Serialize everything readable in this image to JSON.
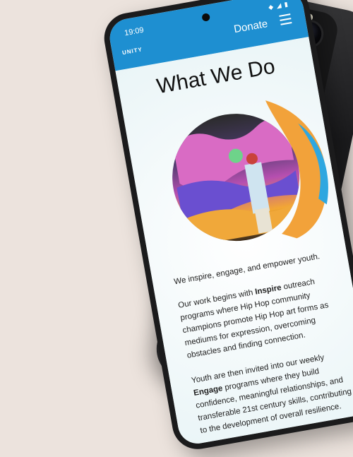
{
  "status": {
    "time": "19:09",
    "icons": "◆ ◢ ▮"
  },
  "header": {
    "logo": "UNITY",
    "donate_label": "Donate"
  },
  "main": {
    "title": "What We Do",
    "intro": "We inspire, engage, and empower youth.",
    "p1": {
      "before": "Our work begins with ",
      "strong": "Inspire",
      "after": " outreach programs where Hip Hop community champions promote Hip Hop art forms as mediums for expression, overcoming obstacles and finding connection."
    },
    "p2": {
      "before": "Youth are then invited into our weekly ",
      "strong": "Engage",
      "after": " programs where they build confidence, meaningful relationships, and transferable 21st century skills, contributing to the development of overall resilience."
    }
  },
  "colors": {
    "brand_blue": "#1e8fd1"
  }
}
